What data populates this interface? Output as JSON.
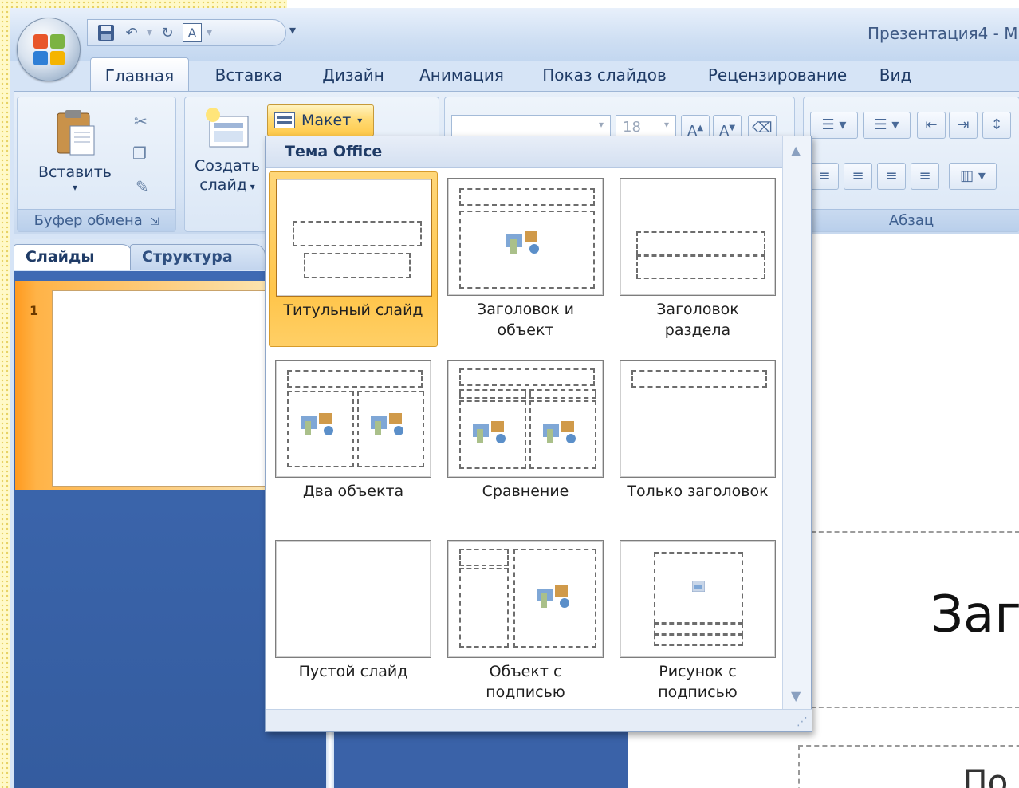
{
  "window": {
    "title": "Презентация4 - М"
  },
  "tabs": [
    "Главная",
    "Вставка",
    "Дизайн",
    "Анимация",
    "Показ слайдов",
    "Рецензирование",
    "Вид"
  ],
  "ribbon": {
    "paste_label": "Вставить",
    "clipboard_group": "Буфер обмена",
    "new_slide_label": "Создать",
    "new_slide_label2": "слайд",
    "layout_button": "Макет",
    "font_size": "18",
    "paragraph_group": "Абзац"
  },
  "pane": {
    "tab_slides": "Слайды",
    "tab_outline": "Структура",
    "slide_number": "1"
  },
  "gallery": {
    "header": "Тема Office",
    "layouts": [
      {
        "label": "Титульный слайд",
        "selected": true
      },
      {
        "label": "Заголовок и объект"
      },
      {
        "label": "Заголовок раздела"
      },
      {
        "label": "Два объекта"
      },
      {
        "label": "Сравнение"
      },
      {
        "label": "Только заголовок"
      },
      {
        "label": "Пустой слайд"
      },
      {
        "label": "Объект с подписью"
      },
      {
        "label": "Рисунок с подписью"
      }
    ]
  },
  "slide": {
    "title_fragment": "Заг",
    "subtitle_fragment": "По"
  },
  "icons": {
    "office_button": "office-logo-icon",
    "save": "save-icon",
    "undo": "undo-icon",
    "redo": "redo-icon",
    "layout": "layout-icon"
  },
  "colors": {
    "accent": "#ffc94a",
    "ribbon": "#d8e5f5",
    "pane": "#3a62a8"
  }
}
